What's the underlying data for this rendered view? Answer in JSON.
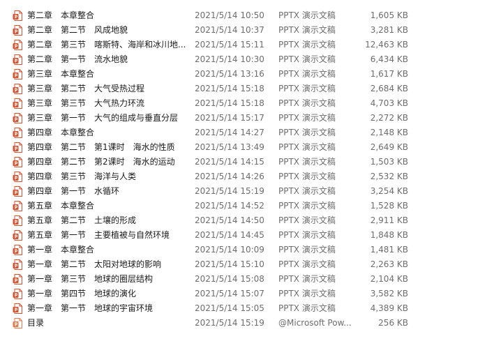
{
  "files": [
    {
      "name": "第二章　本章整合",
      "date": "2021/5/14 10:50",
      "type": "PPTX 演示文稿",
      "size": "1,605 KB",
      "icon": "pptx-file-icon"
    },
    {
      "name": "第二章　第二节　风成地貌",
      "date": "2021/5/14 10:37",
      "type": "PPTX 演示文稿",
      "size": "3,281 KB",
      "icon": "pptx-file-icon"
    },
    {
      "name": "第二章　第三节　喀斯特、海岸和冰川地...",
      "date": "2021/5/14 15:11",
      "type": "PPTX 演示文稿",
      "size": "12,463 KB",
      "icon": "pptx-file-icon"
    },
    {
      "name": "第二章　第一节　流水地貌",
      "date": "2021/5/14 10:30",
      "type": "PPTX 演示文稿",
      "size": "6,434 KB",
      "icon": "pptx-file-icon"
    },
    {
      "name": "第三章　本章整合",
      "date": "2021/5/14 13:16",
      "type": "PPTX 演示文稿",
      "size": "1,617 KB",
      "icon": "pptx-file-icon"
    },
    {
      "name": "第三章　第二节　大气受热过程",
      "date": "2021/5/14 15:18",
      "type": "PPTX 演示文稿",
      "size": "2,684 KB",
      "icon": "pptx-file-icon"
    },
    {
      "name": "第三章　第三节　大气热力环流",
      "date": "2021/5/14 15:18",
      "type": "PPTX 演示文稿",
      "size": "4,703 KB",
      "icon": "pptx-file-icon"
    },
    {
      "name": "第三章　第一节　大气的组成与垂直分层",
      "date": "2021/5/14 15:17",
      "type": "PPTX 演示文稿",
      "size": "2,272 KB",
      "icon": "pptx-file-icon"
    },
    {
      "name": "第四章　本章整合",
      "date": "2021/5/14 14:27",
      "type": "PPTX 演示文稿",
      "size": "2,148 KB",
      "icon": "pptx-file-icon"
    },
    {
      "name": "第四章　第二节　第1课时　海水的性质",
      "date": "2021/5/14 13:49",
      "type": "PPTX 演示文稿",
      "size": "2,649 KB",
      "icon": "pptx-file-icon"
    },
    {
      "name": "第四章　第二节　第2课时　海水的运动",
      "date": "2021/5/14 14:15",
      "type": "PPTX 演示文稿",
      "size": "1,503 KB",
      "icon": "pptx-file-icon"
    },
    {
      "name": "第四章　第三节　海洋与人类",
      "date": "2021/5/14 14:26",
      "type": "PPTX 演示文稿",
      "size": "2,532 KB",
      "icon": "pptx-file-icon"
    },
    {
      "name": "第四章　第一节　水循环",
      "date": "2021/5/14 15:19",
      "type": "PPTX 演示文稿",
      "size": "3,254 KB",
      "icon": "pptx-file-icon"
    },
    {
      "name": "第五章　本章整合",
      "date": "2021/5/14 14:52",
      "type": "PPTX 演示文稿",
      "size": "1,528 KB",
      "icon": "pptx-file-icon"
    },
    {
      "name": "第五章　第二节　土壤的形成",
      "date": "2021/5/14 14:50",
      "type": "PPTX 演示文稿",
      "size": "2,911 KB",
      "icon": "pptx-file-icon"
    },
    {
      "name": "第五章　第一节　主要植被与自然环境",
      "date": "2021/5/14 14:45",
      "type": "PPTX 演示文稿",
      "size": "1,848 KB",
      "icon": "pptx-file-icon"
    },
    {
      "name": "第一章　本章整合",
      "date": "2021/5/14 10:09",
      "type": "PPTX 演示文稿",
      "size": "1,481 KB",
      "icon": "pptx-file-icon"
    },
    {
      "name": "第一章　第二节　太阳对地球的影响",
      "date": "2021/5/14 15:10",
      "type": "PPTX 演示文稿",
      "size": "2,263 KB",
      "icon": "pptx-file-icon"
    },
    {
      "name": "第一章　第三节　地球的圈层结构",
      "date": "2021/5/14 15:08",
      "type": "PPTX 演示文稿",
      "size": "2,104 KB",
      "icon": "pptx-file-icon"
    },
    {
      "name": "第一章　第四节　地球的演化",
      "date": "2021/5/14 15:07",
      "type": "PPTX 演示文稿",
      "size": "3,582 KB",
      "icon": "pptx-file-icon"
    },
    {
      "name": "第一章　第一节　地球的宇宙环境",
      "date": "2021/5/14 15:05",
      "type": "PPTX 演示文稿",
      "size": "4,389 KB",
      "icon": "pptx-file-icon"
    },
    {
      "name": "目录",
      "date": "2021/5/14 15:19",
      "type": "@Microsoft Pow...",
      "size": "256 KB",
      "icon": "ppsx-file-icon"
    }
  ],
  "colors": {
    "pptx_icon": "#d35230",
    "ppsx_icon": "#e07a4a",
    "secondary_text": "#6d6d6d"
  }
}
